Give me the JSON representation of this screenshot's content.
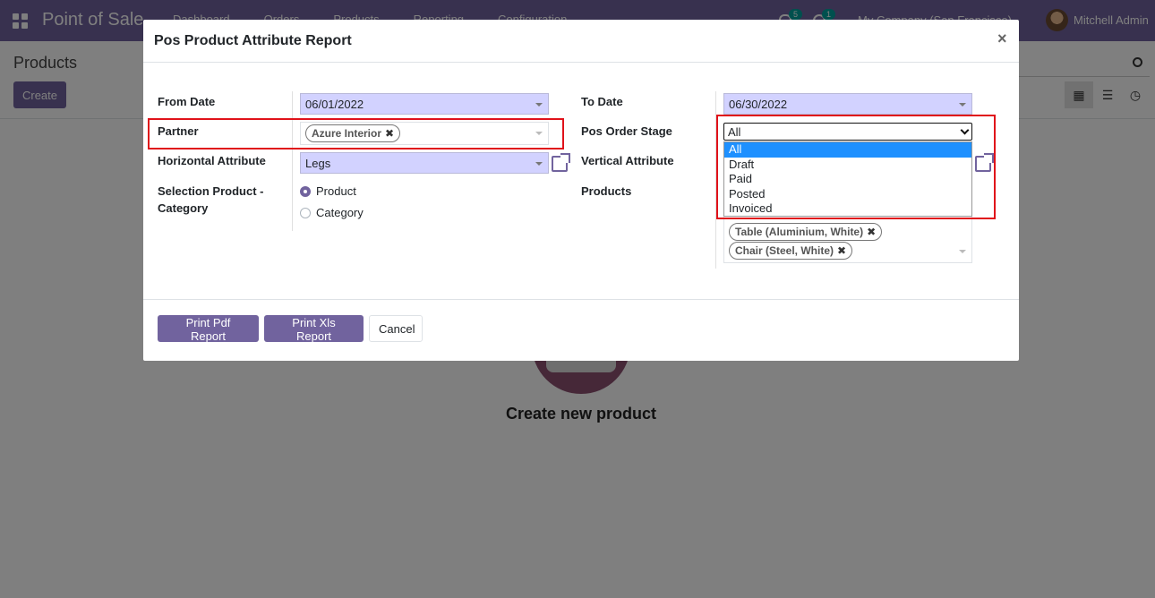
{
  "navbar": {
    "brand": "Point of Sale",
    "menu": [
      "Dashboard",
      "Orders",
      "Products",
      "Reporting",
      "Configuration"
    ],
    "chat_count": "5",
    "activity_count": "1",
    "company": "My Company (San Francisco)",
    "user": "Mitchell Admin"
  },
  "control": {
    "title": "Products",
    "create_label": "Create"
  },
  "main": {
    "empty_title": "Create new product"
  },
  "modal": {
    "title": "Pos Product Attribute Report",
    "close": "×",
    "labels": {
      "from_date": "From Date",
      "to_date": "To Date",
      "partner": "Partner",
      "order_stage": "Pos Order Stage",
      "horizontal_attribute": "Horizontal Attribute",
      "vertical_attribute": "Vertical Attribute",
      "selection": "Selection Product -",
      "selection_line2": "Category",
      "products": "Products"
    },
    "values": {
      "from_date": "06/01/2022",
      "to_date": "06/30/2022",
      "partner_tag": "Azure Interior",
      "horizontal_attribute": "Legs",
      "order_stage": "All"
    },
    "selection_options": [
      "Product",
      "Category"
    ],
    "order_stage_options": [
      "All",
      "Draft",
      "Paid",
      "Posted",
      "Invoiced"
    ],
    "product_tags": [
      "Table (Aluminium, White)",
      "Chair (Steel, White)"
    ],
    "buttons": {
      "print_pdf": "Print Pdf Report",
      "print_xls": "Print Xls Report",
      "cancel": "Cancel"
    }
  },
  "colors": {
    "brand": "#71639e",
    "highlight": "#e0121a",
    "field_bg": "#d2d2ff",
    "dropdown_selected": "#1e90ff"
  }
}
